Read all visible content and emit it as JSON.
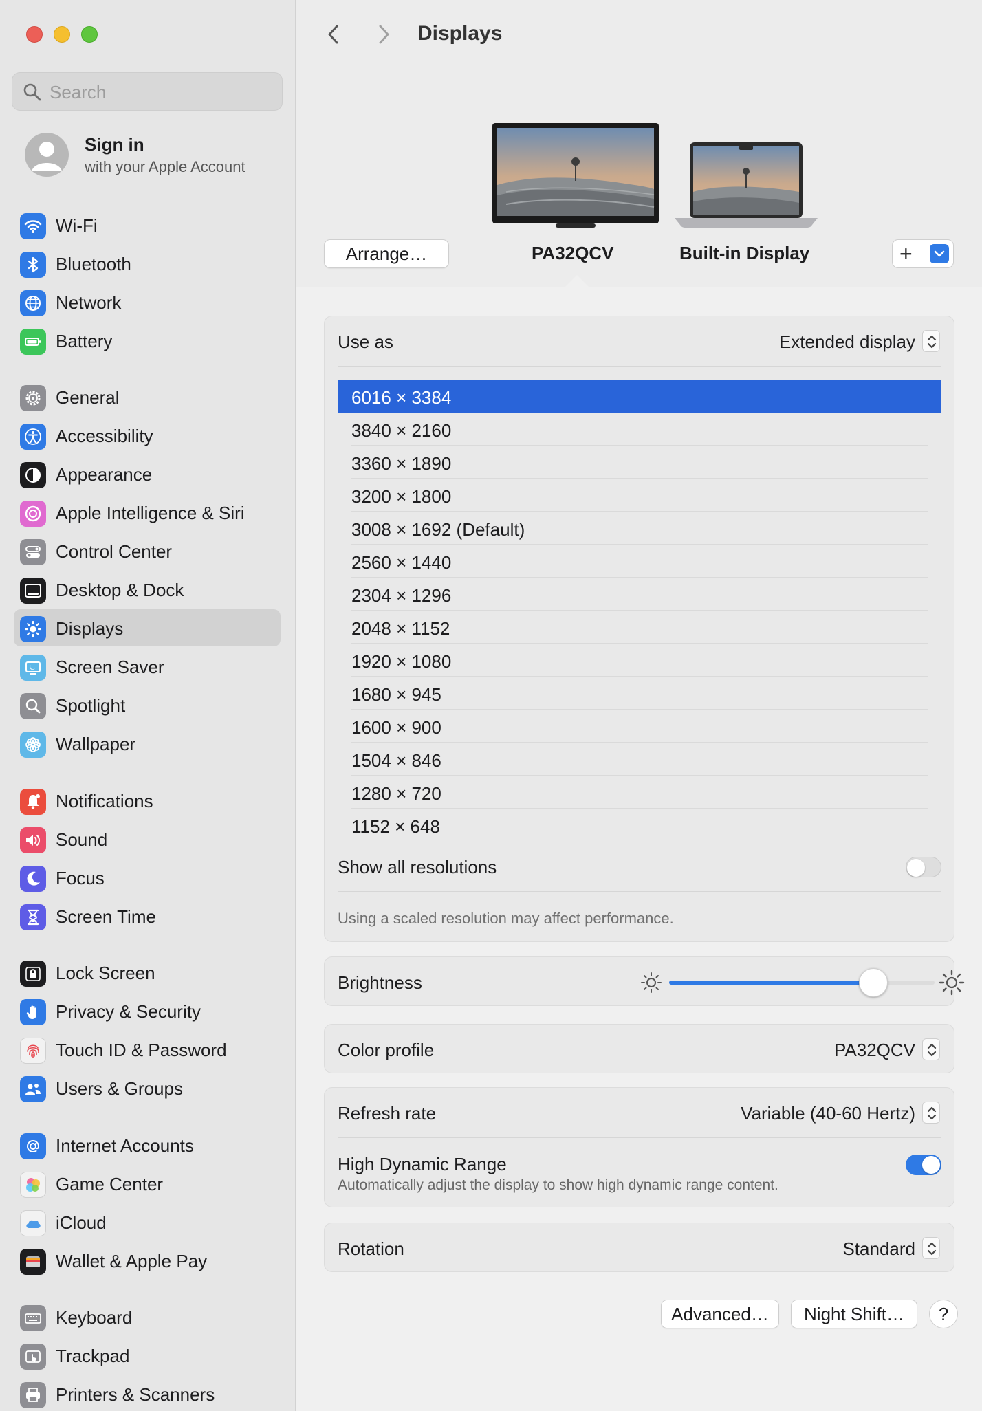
{
  "sidebar": {
    "search_placeholder": "Search",
    "account": {
      "name": "Sign in",
      "subtitle": "with your Apple Account"
    },
    "items": [
      {
        "label": "Wi-Fi",
        "icon": "wifi-icon",
        "color": "#2f7ae5"
      },
      {
        "label": "Bluetooth",
        "icon": "bluetooth-icon",
        "color": "#2f7ae5"
      },
      {
        "label": "Network",
        "icon": "globe-icon",
        "color": "#2f7ae5"
      },
      {
        "label": "Battery",
        "icon": "battery-icon",
        "color": "#3cc65a"
      },
      {
        "label": "General",
        "icon": "gear-icon",
        "color": "#8e8e93"
      },
      {
        "label": "Accessibility",
        "icon": "accessibility-icon",
        "color": "#2f7ae5"
      },
      {
        "label": "Appearance",
        "icon": "appearance-icon",
        "color": "#1d1d1f"
      },
      {
        "label": "Apple Intelligence & Siri",
        "icon": "siri-icon",
        "color": "#e06ad0"
      },
      {
        "label": "Control Center",
        "icon": "control-center-icon",
        "color": "#8e8e93"
      },
      {
        "label": "Desktop & Dock",
        "icon": "dock-icon",
        "color": "#1d1d1f"
      },
      {
        "label": "Displays",
        "icon": "sun-icon",
        "color": "#2f7ae5"
      },
      {
        "label": "Screen Saver",
        "icon": "screen-saver-icon",
        "color": "#5fb8e8"
      },
      {
        "label": "Spotlight",
        "icon": "magnifier-icon",
        "color": "#8e8e93"
      },
      {
        "label": "Wallpaper",
        "icon": "flower-icon",
        "color": "#5fb8e8"
      },
      {
        "label": "Notifications",
        "icon": "bell-icon",
        "color": "#eb4d3d"
      },
      {
        "label": "Sound",
        "icon": "speaker-icon",
        "color": "#eb4d6a"
      },
      {
        "label": "Focus",
        "icon": "moon-icon",
        "color": "#5e5ce6"
      },
      {
        "label": "Screen Time",
        "icon": "hourglass-icon",
        "color": "#5e5ce6"
      },
      {
        "label": "Lock Screen",
        "icon": "lock-icon",
        "color": "#1d1d1f"
      },
      {
        "label": "Privacy & Security",
        "icon": "hand-icon",
        "color": "#2f7ae5"
      },
      {
        "label": "Touch ID & Password",
        "icon": "fingerprint-icon",
        "color": "#f2f2f2"
      },
      {
        "label": "Users & Groups",
        "icon": "users-icon",
        "color": "#2f7ae5"
      },
      {
        "label": "Internet Accounts",
        "icon": "at-icon",
        "color": "#2f7ae5"
      },
      {
        "label": "Game Center",
        "icon": "game-center-icon",
        "color": "#f2f2f2"
      },
      {
        "label": "iCloud",
        "icon": "cloud-icon",
        "color": "#f2f2f2"
      },
      {
        "label": "Wallet & Apple Pay",
        "icon": "wallet-icon",
        "color": "#1d1d1f"
      },
      {
        "label": "Keyboard",
        "icon": "keyboard-icon",
        "color": "#8e8e93"
      },
      {
        "label": "Trackpad",
        "icon": "trackpad-icon",
        "color": "#8e8e93"
      },
      {
        "label": "Printers & Scanners",
        "icon": "printer-icon",
        "color": "#8e8e93"
      }
    ],
    "selected_index": 10
  },
  "header": {
    "title": "Displays",
    "arrange_label": "Arrange…",
    "displays": [
      {
        "name": "PA32QCV",
        "selected": true
      },
      {
        "name": "Built-in Display",
        "selected": false
      }
    ],
    "add_label": "+"
  },
  "use_as": {
    "label": "Use as",
    "value": "Extended display"
  },
  "resolutions": {
    "items": [
      "6016 × 3384",
      "3840 × 2160",
      "3360 × 1890",
      "3200 × 1800",
      "3008 × 1692 (Default)",
      "2560 × 1440",
      "2304 × 1296",
      "2048 × 1152",
      "1920 × 1080",
      "1680 × 945",
      "1600 × 900",
      "1504 × 846",
      "1280 × 720",
      "1152 × 648"
    ],
    "selected_index": 0,
    "show_all_label": "Show all resolutions",
    "show_all_on": false,
    "note": "Using a scaled resolution may affect performance."
  },
  "brightness": {
    "label": "Brightness",
    "level": 0.77
  },
  "color_profile": {
    "label": "Color profile",
    "value": "PA32QCV"
  },
  "refresh": {
    "label": "Refresh rate",
    "value": "Variable (40-60 Hertz)",
    "hdr_label": "High Dynamic Range",
    "hdr_desc": "Automatically adjust the display to show high dynamic range content.",
    "hdr_on": true
  },
  "rotation": {
    "label": "Rotation",
    "value": "Standard"
  },
  "footer": {
    "advanced_label": "Advanced…",
    "night_shift_label": "Night Shift…",
    "help_label": "?"
  },
  "colors": {
    "accent": "#2f7ae5",
    "selection": "#2964d9"
  }
}
